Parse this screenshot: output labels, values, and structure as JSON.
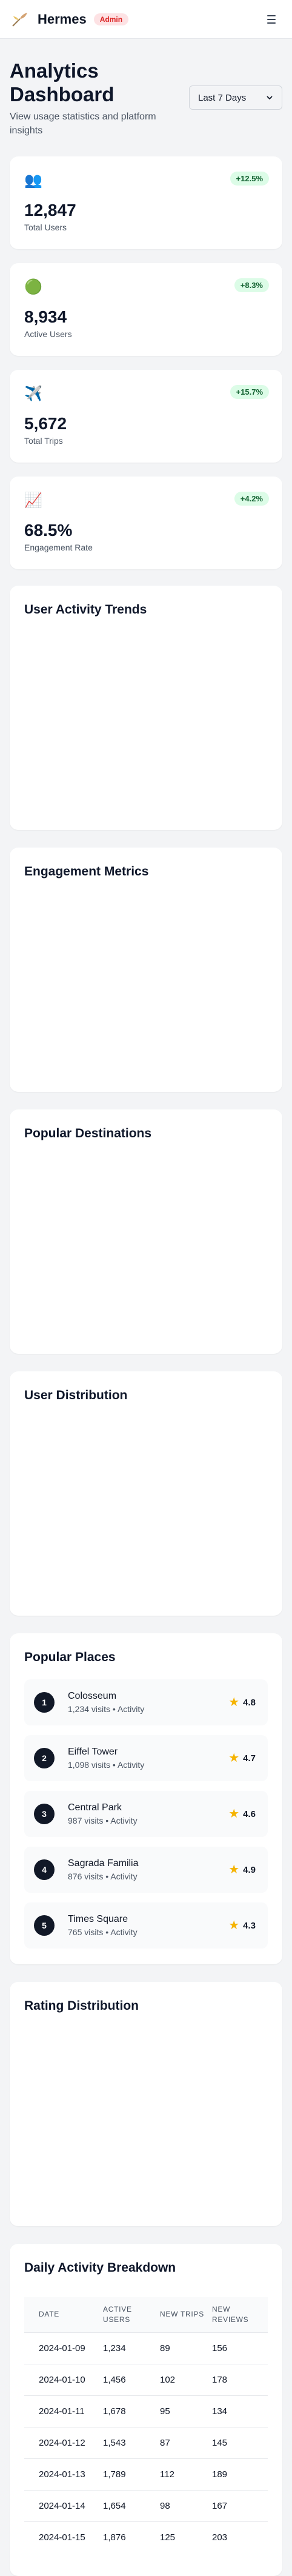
{
  "header": {
    "brand": "Hermes",
    "badge": "Admin"
  },
  "page": {
    "title": "Analytics Dashboard",
    "subtitle": "View usage statistics and platform insights",
    "period": "Last 7 Days"
  },
  "stats": [
    {
      "icon": "👥",
      "icon_name": "users-icon",
      "value": "12,847",
      "label": "Total Users",
      "change": "+12.5%"
    },
    {
      "icon": "🟢",
      "icon_name": "green-dot-icon",
      "value": "8,934",
      "label": "Active Users",
      "change": "+8.3%"
    },
    {
      "icon": "✈️",
      "icon_name": "airplane-icon",
      "value": "5,672",
      "label": "Total Trips",
      "change": "+15.7%"
    },
    {
      "icon": "📈",
      "icon_name": "chart-up-icon",
      "value": "68.5%",
      "label": "Engagement Rate",
      "change": "+4.2%"
    }
  ],
  "sections": {
    "activity": "User Activity Trends",
    "engagement": "Engagement Metrics",
    "destinations": "Popular Destinations",
    "distribution": "User Distribution",
    "places": "Popular Places",
    "ratings": "Rating Distribution",
    "daily": "Daily Activity Breakdown"
  },
  "places": [
    {
      "rank": "1",
      "name": "Colosseum",
      "meta": "1,234 visits • Activity",
      "rating": "4.8"
    },
    {
      "rank": "2",
      "name": "Eiffel Tower",
      "meta": "1,098 visits • Activity",
      "rating": "4.7"
    },
    {
      "rank": "3",
      "name": "Central Park",
      "meta": "987 visits • Activity",
      "rating": "4.6"
    },
    {
      "rank": "4",
      "name": "Sagrada Familia",
      "meta": "876 visits • Activity",
      "rating": "4.9"
    },
    {
      "rank": "5",
      "name": "Times Square",
      "meta": "765 visits • Activity",
      "rating": "4.3"
    }
  ],
  "daily_table": {
    "headers": [
      "DATE",
      "ACTIVE USERS",
      "NEW TRIPS",
      "NEW REVIEWS"
    ],
    "rows": [
      [
        "2024-01-09",
        "1,234",
        "89",
        "156"
      ],
      [
        "2024-01-10",
        "1,456",
        "102",
        "178"
      ],
      [
        "2024-01-11",
        "1,678",
        "95",
        "134"
      ],
      [
        "2024-01-12",
        "1,543",
        "87",
        "145"
      ],
      [
        "2024-01-13",
        "1,789",
        "112",
        "189"
      ],
      [
        "2024-01-14",
        "1,654",
        "98",
        "167"
      ],
      [
        "2024-01-15",
        "1,876",
        "125",
        "203"
      ]
    ]
  },
  "colors": {
    "accent_dark": "#111827",
    "badge_green_bg": "#dcfce7",
    "badge_green_text": "#166534",
    "admin_bg": "#fde2e4",
    "admin_text": "#dc2626",
    "star": "#f5b301"
  }
}
